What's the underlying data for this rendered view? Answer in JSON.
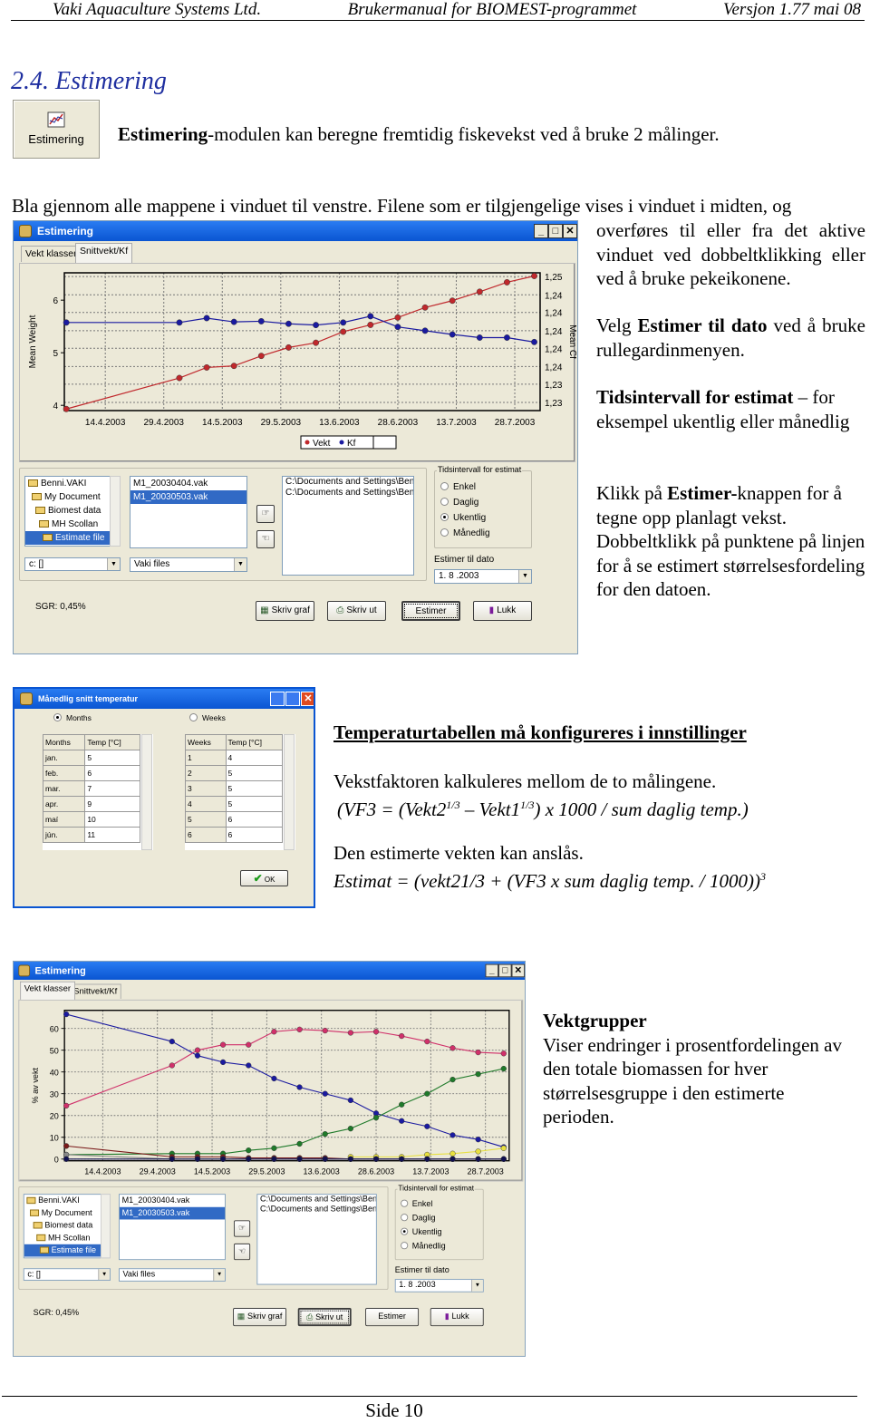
{
  "header": {
    "company": "Vaki Aquaculture Systems Ltd.",
    "manual": "Brukermanual for BIOMEST-programmet",
    "version": "Versjon 1.77  mai 08"
  },
  "heading": "2.4. Estimering",
  "module_icon": {
    "label": "Estimering",
    "icon": "chart-icon"
  },
  "intro": {
    "bold": "Estimering",
    "rest": "-modulen kan beregne fremtidig fiskevekst ved å bruke 2 målinger."
  },
  "para1_full": "Bla gjennom alle mappene i vinduet til venstre. Filene som er tilgjengelige vises i vinduet i midten, og",
  "para1_side": "overføres til eller fra det aktive vinduet ved dobbeltklikking eller ved å bruke pekeikonene.",
  "para2": {
    "pre": "Velg ",
    "bold": "Estimer til dato",
    "post": " ved å bruke rullegardinmenyen."
  },
  "para3": {
    "bold": "Tidsintervall for estimat",
    "post": " – for eksempel ukentlig eller månedlig"
  },
  "para4": {
    "pre": "Klikk på ",
    "bold": "Estimer-",
    "post": "knappen for å tegne opp planlagt vekst. Dobbeltklikk på punktene på linjen for å se estimert størrelsesfordeling for den datoen."
  },
  "temp_note": "Temperaturtabellen må konfigureres i innstillinger",
  "vf_text": "Vekstfaktoren kalkuleres mellom de to målingene.",
  "vf_formula": {
    "a": "(VF3 = (Vekt2",
    "sup1": "1/3",
    "b": " – Vekt1",
    "sup2": "1/3",
    "c": ") x 1000 / sum daglig temp.)"
  },
  "est_text": "Den estimerte vekten kan anslås.",
  "est_formula": {
    "a": "Estimat = (vekt21/3 + (VF3 x sum daglig temp. / 1000))",
    "sup": "3"
  },
  "vektgrupper": {
    "title": "Vektgrupper",
    "text": "Viser endringer i prosentfordelingen av den totale biomassen for hver størrelsesgruppe i den estimerte perioden."
  },
  "footer": "Side 10",
  "colors": {
    "titlebar": "#0a55d2",
    "selection": "#316ac5",
    "vekt": "#c0282c",
    "kf": "#1a1aa0",
    "dialog_bg": "#ece9d8"
  },
  "windows": [
    {
      "title": "Estimering",
      "tabs": [
        "Vekt klasser",
        "Snittvekt/Kf"
      ],
      "active_tab": 1,
      "tree": [
        "Benni.VAKI",
        "My Document",
        "Biomest data",
        "MH Scollan",
        "Estimate file"
      ],
      "tree_selected": 4,
      "files": [
        "M1_20030404.vak",
        "M1_20030503.vak"
      ],
      "file_selected": 1,
      "drive": "c: []",
      "filter": "Vaki files",
      "selected_files": [
        "C:\\Documents and Settings\\Ben",
        "C:\\Documents and Settings\\Ben"
      ],
      "interval_title": "Tidsintervall for estimat",
      "intervals": [
        "Enkel",
        "Daglig",
        "Ukentlig",
        "Månedlig"
      ],
      "interval_selected": 2,
      "date_label": "Estimer til dato",
      "date_value": "1. 8 .2003",
      "sgr": "SGR: 0,45%",
      "buttons": [
        "Skriv graf",
        "Skriv ut",
        "Estimer",
        "Lukk"
      ],
      "focused_button": 2
    },
    {
      "title": "Estimering",
      "tabs": [
        "Vekt klasser",
        "Snittvekt/Kf"
      ],
      "active_tab": 0,
      "tree": [
        "Benni.VAKI",
        "My Document",
        "Biomest data",
        "MH Scollan",
        "Estimate file"
      ],
      "tree_selected": 4,
      "files": [
        "M1_20030404.vak",
        "M1_20030503.vak"
      ],
      "file_selected": 1,
      "drive": "c: []",
      "filter": "Vaki files",
      "selected_files": [
        "C:\\Documents and Settings\\Ben",
        "C:\\Documents and Settings\\Ben"
      ],
      "interval_title": "Tidsintervall for estimat",
      "intervals": [
        "Enkel",
        "Daglig",
        "Ukentlig",
        "Månedlig"
      ],
      "interval_selected": 2,
      "date_label": "Estimer til dato",
      "date_value": "1. 8 .2003",
      "sgr": "SGR: 0,45%",
      "buttons": [
        "Skriv graf",
        "Skriv ut",
        "Estimer",
        "Lukk"
      ],
      "focused_button": 1
    }
  ],
  "temp_dialog": {
    "title": "Månedlig snitt temperatur",
    "radio_months": "Months",
    "radio_weeks": "Weeks",
    "selected": "Months",
    "months_headers": [
      "Months",
      "Temp [°C]"
    ],
    "months_rows": [
      [
        "jan.",
        "5"
      ],
      [
        "feb.",
        "6"
      ],
      [
        "mar.",
        "7"
      ],
      [
        "apr.",
        "9"
      ],
      [
        "maí",
        "10"
      ],
      [
        "jún.",
        "11"
      ]
    ],
    "weeks_headers": [
      "Weeks",
      "Temp [°C]"
    ],
    "weeks_rows": [
      [
        "1",
        "4"
      ],
      [
        "2",
        "5"
      ],
      [
        "3",
        "5"
      ],
      [
        "4",
        "5"
      ],
      [
        "5",
        "6"
      ],
      [
        "6",
        "6"
      ]
    ],
    "ok": "OK"
  },
  "chart_data": [
    {
      "type": "line",
      "ylabel": "Mean Weight",
      "y2label": "Mean Cf",
      "xlim": [
        "2003-04-03",
        "2003-08-03"
      ],
      "xticks": [
        "14.4.2003",
        "29.4.2003",
        "14.5.2003",
        "29.5.2003",
        "13.6.2003",
        "28.6.2003",
        "13.7.2003",
        "28.7.2003"
      ],
      "xtick_dates": [
        "2003-04-14",
        "2003-04-29",
        "2003-05-14",
        "2003-05-29",
        "2003-06-13",
        "2003-06-28",
        "2003-07-13",
        "2003-07-28"
      ],
      "ylim": [
        3.9,
        6.52
      ],
      "yticks": [
        4,
        5,
        6
      ],
      "y2lim": [
        1.2287,
        1.2506
      ],
      "y2ticks": [
        1.25,
        1.2471,
        1.2443,
        1.2414,
        1.2386,
        1.2357,
        1.2329,
        1.23
      ],
      "y2tick_labels": [
        "1,25",
        "1,24",
        "1,24",
        "1,24",
        "1,24",
        "1,24",
        "1,23",
        "1,23"
      ],
      "grid": true,
      "legend": "bottom-center",
      "x": [
        "2003-04-04",
        "2003-05-03",
        "2003-05-10",
        "2003-05-17",
        "2003-05-24",
        "2003-05-31",
        "2003-06-07",
        "2003-06-14",
        "2003-06-21",
        "2003-06-28",
        "2003-07-05",
        "2003-07-12",
        "2003-07-19",
        "2003-07-26",
        "2003-08-02"
      ],
      "series": [
        {
          "name": "Vekt",
          "axis": "left",
          "color": "#c0282c",
          "values": [
            3.93,
            4.52,
            4.72,
            4.75,
            4.94,
            5.1,
            5.19,
            5.4,
            5.53,
            5.67,
            5.86,
            5.99,
            6.16,
            6.34,
            6.46
          ]
        },
        {
          "name": "Kf",
          "axis": "right",
          "color": "#1a1aa0",
          "values": [
            1.2427,
            1.2427,
            1.2434,
            1.2428,
            1.2429,
            1.2425,
            1.2423,
            1.2427,
            1.2437,
            1.242,
            1.2414,
            1.2408,
            1.2403,
            1.2403,
            1.2396
          ]
        }
      ]
    },
    {
      "type": "line",
      "ylabel": "% av vekt",
      "xlim": [
        "2003-04-03",
        "2003-08-03"
      ],
      "xticks": [
        "14.4.2003",
        "29.4.2003",
        "14.5.2003",
        "29.5.2003",
        "13.6.2003",
        "28.6.2003",
        "13.7.2003",
        "28.7.2003"
      ],
      "xtick_dates": [
        "2003-04-14",
        "2003-04-29",
        "2003-05-14",
        "2003-05-29",
        "2003-06-13",
        "2003-06-28",
        "2003-07-13",
        "2003-07-28"
      ],
      "ylim": [
        -0.8,
        68.3
      ],
      "yticks": [
        0,
        10,
        20,
        30,
        40,
        50,
        60
      ],
      "grid": true,
      "x": [
        "2003-04-04",
        "2003-05-03",
        "2003-05-10",
        "2003-05-17",
        "2003-05-24",
        "2003-05-31",
        "2003-06-07",
        "2003-06-14",
        "2003-06-21",
        "2003-06-28",
        "2003-07-05",
        "2003-07-12",
        "2003-07-19",
        "2003-07-26",
        "2003-08-02"
      ],
      "series": [
        {
          "color": "#1a1aa0",
          "values": [
            66.5,
            54,
            47.5,
            44.5,
            43,
            37,
            33,
            30,
            27,
            21,
            17.5,
            15,
            11,
            9,
            5.5
          ]
        },
        {
          "color": "#d0306a",
          "values": [
            24.5,
            43,
            50,
            52.5,
            52.5,
            58.5,
            59.5,
            59,
            58,
            58.5,
            56.5,
            54,
            51,
            49,
            48.5
          ]
        },
        {
          "color": "#1f7a2a",
          "values": [
            2,
            2.5,
            2.5,
            2.5,
            4,
            5,
            7,
            11.5,
            14,
            19,
            25,
            30,
            36.5,
            39,
            41.5
          ]
        },
        {
          "color": "#7a1a1a",
          "values": [
            6,
            1,
            1,
            1,
            0.5,
            0.5,
            0.5,
            0.5,
            0,
            0,
            0,
            0,
            0,
            0,
            0
          ]
        },
        {
          "color": "#e8e040",
          "values": [
            null,
            null,
            null,
            null,
            null,
            null,
            null,
            null,
            1,
            1,
            1,
            2,
            2.5,
            3.5,
            5
          ]
        },
        {
          "color": "#888888",
          "values": [
            2,
            0,
            0,
            0,
            0,
            0,
            0,
            0,
            0,
            0,
            0,
            0,
            0,
            0,
            0
          ]
        },
        {
          "color": "#101050",
          "values": [
            0,
            0,
            0,
            0,
            0,
            0,
            0,
            0,
            0,
            0,
            0,
            0,
            0,
            0,
            0
          ]
        }
      ]
    }
  ]
}
